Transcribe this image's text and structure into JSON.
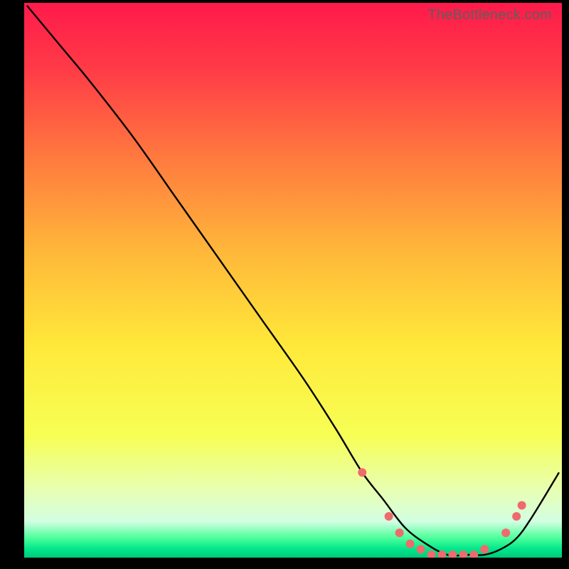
{
  "watermark": "TheBottleneck.com",
  "chart_data": {
    "type": "line",
    "title": "",
    "xlabel": "",
    "ylabel": "",
    "xlim": [
      0,
      100
    ],
    "ylim": [
      0,
      100
    ],
    "background_gradient": {
      "stops": [
        {
          "offset": 0.0,
          "color": "#ff1a4b"
        },
        {
          "offset": 0.12,
          "color": "#ff3b47"
        },
        {
          "offset": 0.28,
          "color": "#ff7a3e"
        },
        {
          "offset": 0.45,
          "color": "#ffb83a"
        },
        {
          "offset": 0.62,
          "color": "#ffe93a"
        },
        {
          "offset": 0.78,
          "color": "#f7ff55"
        },
        {
          "offset": 0.88,
          "color": "#e7ffb4"
        },
        {
          "offset": 0.935,
          "color": "#d2ffe2"
        },
        {
          "offset": 0.965,
          "color": "#4bff9a"
        },
        {
          "offset": 0.985,
          "color": "#00e58a"
        },
        {
          "offset": 1.0,
          "color": "#00c97a"
        }
      ]
    },
    "series": [
      {
        "name": "bottleneck-curve",
        "x": [
          0,
          6,
          12,
          20,
          28,
          36,
          44,
          52,
          58,
          63,
          67,
          71,
          75,
          79,
          83,
          86,
          89,
          92,
          95,
          100
        ],
        "y": [
          100,
          93,
          86,
          76,
          65,
          54,
          43,
          32,
          23,
          15,
          10,
          5,
          2,
          0,
          0,
          0,
          1,
          3,
          7,
          15
        ]
      }
    ],
    "markers": {
      "name": "highlight-points",
      "color": "#ef6a6d",
      "radius": 6,
      "points": [
        {
          "x": 63,
          "y": 15
        },
        {
          "x": 68,
          "y": 7
        },
        {
          "x": 70,
          "y": 4
        },
        {
          "x": 72,
          "y": 2
        },
        {
          "x": 74,
          "y": 1
        },
        {
          "x": 76,
          "y": 0
        },
        {
          "x": 78,
          "y": 0
        },
        {
          "x": 80,
          "y": 0
        },
        {
          "x": 82,
          "y": 0
        },
        {
          "x": 84,
          "y": 0
        },
        {
          "x": 86,
          "y": 1
        },
        {
          "x": 90,
          "y": 4
        },
        {
          "x": 92,
          "y": 7
        },
        {
          "x": 93,
          "y": 9
        }
      ]
    }
  }
}
